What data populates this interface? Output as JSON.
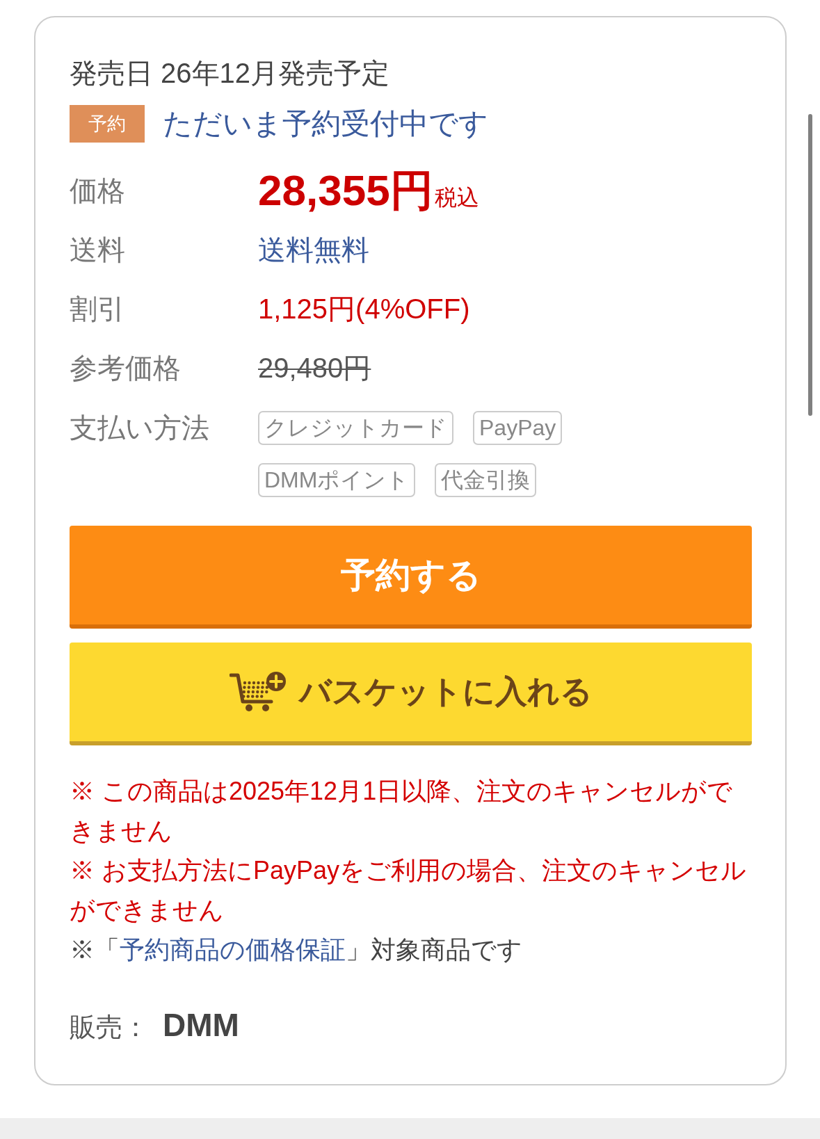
{
  "release_date": "発売日 26年12月発売予定",
  "reservation": {
    "badge": "予約",
    "status": "ただいま予約受付中です"
  },
  "details": [
    {
      "kind": "price",
      "label": "価格",
      "value": "28,355円",
      "suffix": "税込"
    },
    {
      "kind": "shipping",
      "label": "送料",
      "value": "送料無料"
    },
    {
      "kind": "discount",
      "label": "割引",
      "value": "1,125円(4%OFF)"
    },
    {
      "kind": "reference_price",
      "label": "参考価格",
      "value": "29,480円"
    },
    {
      "kind": "payment_methods",
      "label": "支払い方法",
      "tags": [
        "クレジットカード",
        "PayPay",
        "DMMポイント",
        "代金引換"
      ]
    }
  ],
  "buttons": [
    {
      "kind": "reserve",
      "label": "予約する"
    },
    {
      "kind": "basket",
      "label": "バスケットに入れる"
    }
  ],
  "notes": [
    {
      "kind": "warning",
      "text": "※ この商品は2025年12月1日以降、注文のキャンセルができません"
    },
    {
      "kind": "warning",
      "text": "※ お支払方法にPayPayをご利用の場合、注文のキャンセルができません"
    },
    {
      "kind": "guarantee",
      "text_before": "※「",
      "link": "予約商品の価格保証",
      "text_after": "」対象商品です"
    }
  ],
  "seller": {
    "label": "販売：",
    "value": "DMM"
  }
}
